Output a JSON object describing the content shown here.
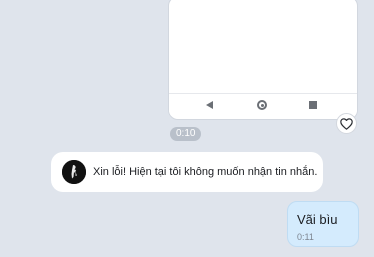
{
  "screenshot_message": {
    "nav": {
      "back_icon": "back-triangle-icon",
      "home_icon": "home-circle-icon",
      "recent_icon": "recent-square-icon"
    },
    "reaction_icon": "heart-icon"
  },
  "messages": [
    {
      "type": "timestamp",
      "text": "0:10"
    },
    {
      "type": "incoming",
      "avatar_icon": "avatar-icon",
      "text": "Xin lỗi! Hiện tại tôi không muốn nhận tin nhắn."
    },
    {
      "type": "outgoing",
      "text": "Vãi bìu",
      "time": "0:11"
    }
  ],
  "colors": {
    "background": "#dfe4ec",
    "outgoing_bubble": "#d4ebfd",
    "incoming_bubble": "#ffffff",
    "timestamp_pill": "#b9c0ca"
  }
}
